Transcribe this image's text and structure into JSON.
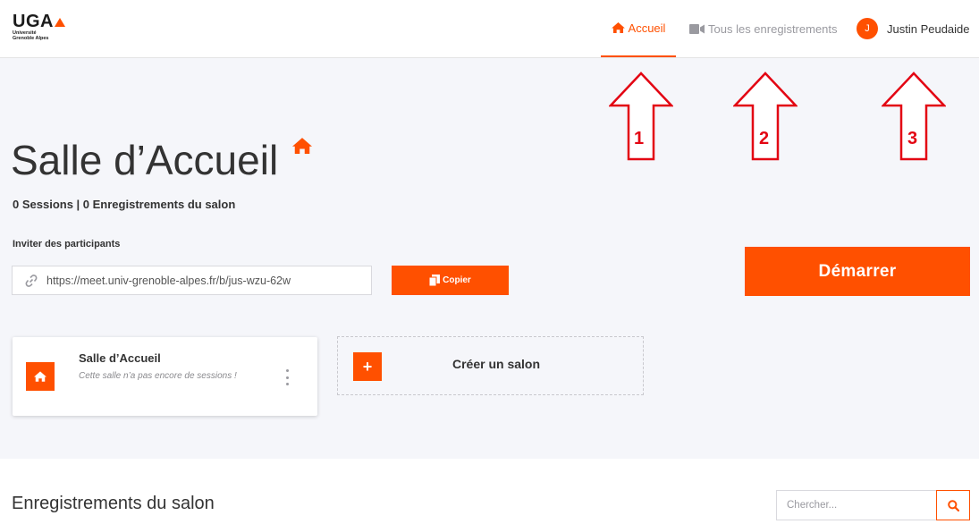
{
  "header": {
    "logo_text": "UGA",
    "logo_sub_line1": "Université",
    "logo_sub_line2": "Grenoble Alpes",
    "nav": {
      "home": "Accueil",
      "recordings": "Tous les enregistrements",
      "user_initial": "J",
      "user_name": "Justin Peudaide"
    }
  },
  "room": {
    "title": "Salle d’Accueil",
    "stats": "0 Sessions | 0 Enregistrements du salon",
    "invite_label": "Inviter des participants",
    "invite_url": "https://meet.univ-grenoble-alpes.fr/b/jus-wzu-62w",
    "copy_label": "Copier",
    "start_label": "Démarrer"
  },
  "room_cards": [
    {
      "name": "Salle d’Accueil",
      "description": "Cette salle n’a pas encore de sessions !"
    }
  ],
  "create_room": {
    "label": "Créer un salon"
  },
  "recordings": {
    "title": "Enregistrements du salon",
    "search_placeholder": "Chercher..."
  },
  "annotations": [
    "1",
    "2",
    "3"
  ],
  "colors": {
    "accent": "#ff5000",
    "annotation": "#e30613",
    "band": "#f5f6fa"
  }
}
